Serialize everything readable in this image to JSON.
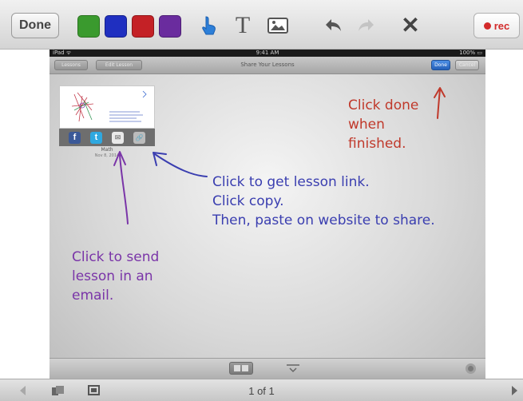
{
  "toolbar": {
    "done_label": "Done",
    "colors": [
      {
        "name": "green",
        "hex": "#3a9a2e"
      },
      {
        "name": "blue",
        "hex": "#1f2fc0"
      },
      {
        "name": "red",
        "hex": "#c42126"
      },
      {
        "name": "purple",
        "hex": "#6a2c9e"
      }
    ],
    "text_tool_glyph": "T",
    "close_glyph": "✕",
    "rec_label": "rec",
    "icons": [
      "pointer-icon",
      "text-icon",
      "image-icon",
      "undo-icon",
      "redo-icon",
      "close-icon",
      "record-icon"
    ]
  },
  "ipad": {
    "status": {
      "left": "iPad ᯤ",
      "center": "9:41 AM",
      "right": "100% ▭"
    },
    "nav": {
      "left1": "Lessons",
      "left2": "Edit Lesson",
      "title": "Share Your Lessons",
      "done": "Done",
      "right": "Cancel"
    },
    "lesson": {
      "name": "Math",
      "date": "Nov 8, 2014"
    },
    "share_icons": [
      {
        "name": "facebook-icon",
        "glyph": "f",
        "color": "#3b5998"
      },
      {
        "name": "twitter-icon",
        "glyph": "t",
        "color": "#2fa8e0"
      },
      {
        "name": "email-icon",
        "glyph": "✉",
        "color": "#e9e9e9"
      },
      {
        "name": "link-icon",
        "glyph": "🔗",
        "color": "#bcbcbc"
      }
    ]
  },
  "annotations": {
    "red": [
      "Click done",
      "when",
      "finished."
    ],
    "blue": [
      "Click to get lesson link.",
      "Click copy.",
      "Then, paste on website to share."
    ],
    "purple": [
      "Click to send",
      "lesson in an",
      "email."
    ],
    "colors": {
      "red": "#c0392b",
      "blue": "#3a3eb0",
      "purple": "#7a35a8"
    }
  },
  "bottom": {
    "page_indicator": "1 of 1"
  }
}
